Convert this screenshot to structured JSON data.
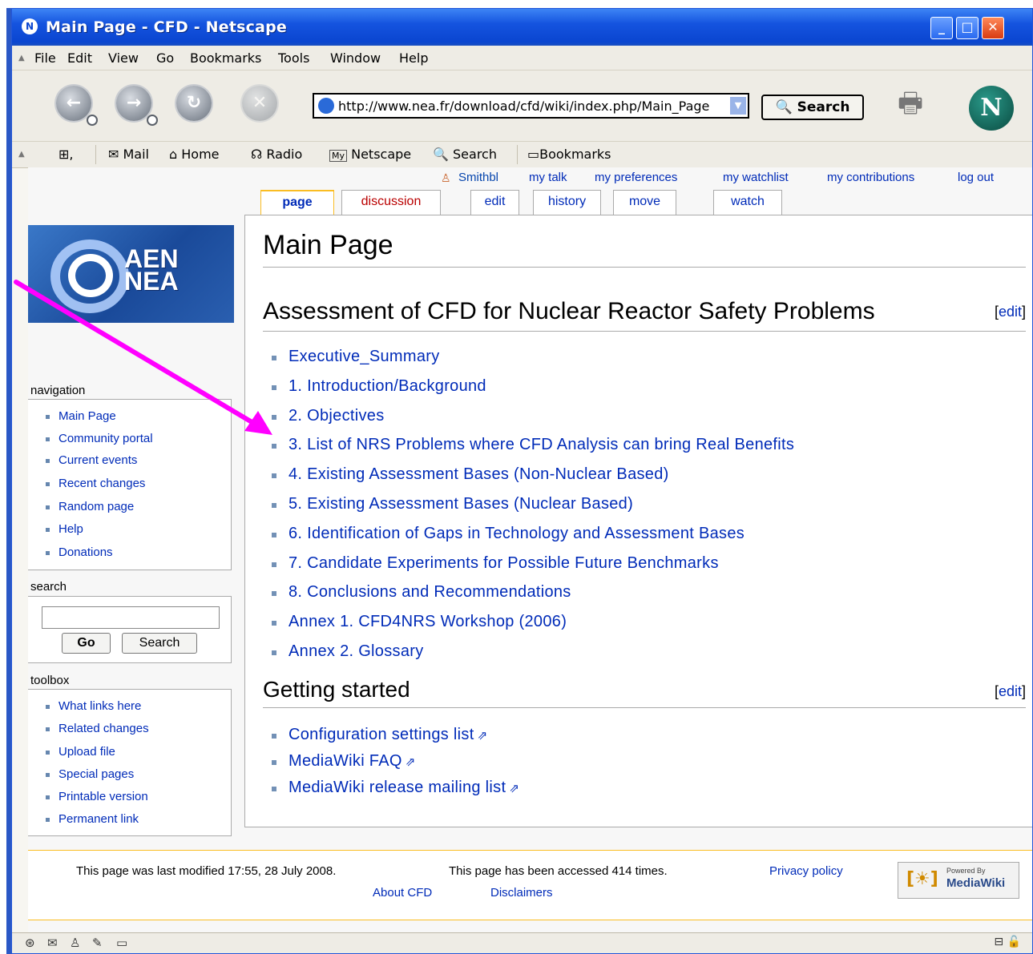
{
  "window": {
    "title": "Main Page - CFD - Netscape",
    "buttons": {
      "minimize": "_",
      "maximize": "□",
      "close": "✕"
    }
  },
  "menubar": [
    "File",
    "Edit",
    "View",
    "Go",
    "Bookmarks",
    "Tools",
    "Window",
    "Help"
  ],
  "navbar": {
    "url": "http://www.nea.fr/download/cfd/wiki/index.php/Main_Page",
    "search_button": "Search"
  },
  "personal_toolbar": [
    "Mail",
    "Home",
    "Radio",
    "Netscape",
    "Search",
    "Bookmarks"
  ],
  "personal_toolbar_icons": [
    "mail-icon",
    "home-icon",
    "radio-icon",
    "my-netscape-icon",
    "search-icon",
    "bookmarks-icon"
  ],
  "userlinks": {
    "user": "Smithbl",
    "mytalk": "my talk",
    "preferences": "my preferences",
    "watchlist": "my watchlist",
    "contributions": "my contributions",
    "logout": "log out"
  },
  "tabs": [
    "page",
    "discussion",
    "edit",
    "history",
    "move",
    "watch"
  ],
  "logo": {
    "line1": "AEN",
    "line2": "NEA"
  },
  "sidebar": {
    "navigation_title": "navigation",
    "navigation": [
      "Main Page",
      "Community portal",
      "Current events",
      "Recent changes",
      "Random page",
      "Help",
      "Donations"
    ],
    "search_title": "search",
    "search_value": "",
    "go_button": "Go",
    "search_button": "Search",
    "toolbox_title": "toolbox",
    "toolbox": [
      "What links here",
      "Related changes",
      "Upload file",
      "Special pages",
      "Printable version",
      "Permanent link"
    ]
  },
  "main": {
    "title": "Main Page",
    "section1": {
      "heading": "Assessment of CFD for Nuclear Reactor Safety Problems",
      "edit_open": "[",
      "edit_label": "edit",
      "edit_close": "]",
      "items": [
        "Executive_Summary",
        "1. Introduction/Background",
        "2. Objectives",
        "3. List of NRS Problems where CFD Analysis can bring Real Benefits",
        "4. Existing Assessment Bases (Non-Nuclear Based)",
        "5. Existing Assessment Bases (Nuclear Based)",
        "6. Identification of Gaps in Technology and Assessment Bases",
        "7. Candidate Experiments for Possible Future Benchmarks",
        "8. Conclusions and Recommendations",
        "Annex 1. CFD4NRS Workshop (2006)",
        "Annex 2. Glossary"
      ]
    },
    "section2": {
      "heading": "Getting started",
      "edit_open": "[",
      "edit_label": "edit",
      "edit_close": "]",
      "items": [
        "Configuration settings list",
        "MediaWiki FAQ",
        "MediaWiki release mailing list"
      ]
    }
  },
  "footer": {
    "lastmod": "This page was last modified 17:55, 28 July 2008.",
    "accessed": "This page has been accessed 414 times.",
    "privacy": "Privacy policy",
    "about": "About CFD",
    "disclaimers": "Disclaimers",
    "powered_small": "Powered By",
    "powered_big": "MediaWiki"
  },
  "colors": {
    "link": "#002bb8",
    "annotation_arrow": "#ff00ff",
    "titlebar": "#0a45d0"
  }
}
